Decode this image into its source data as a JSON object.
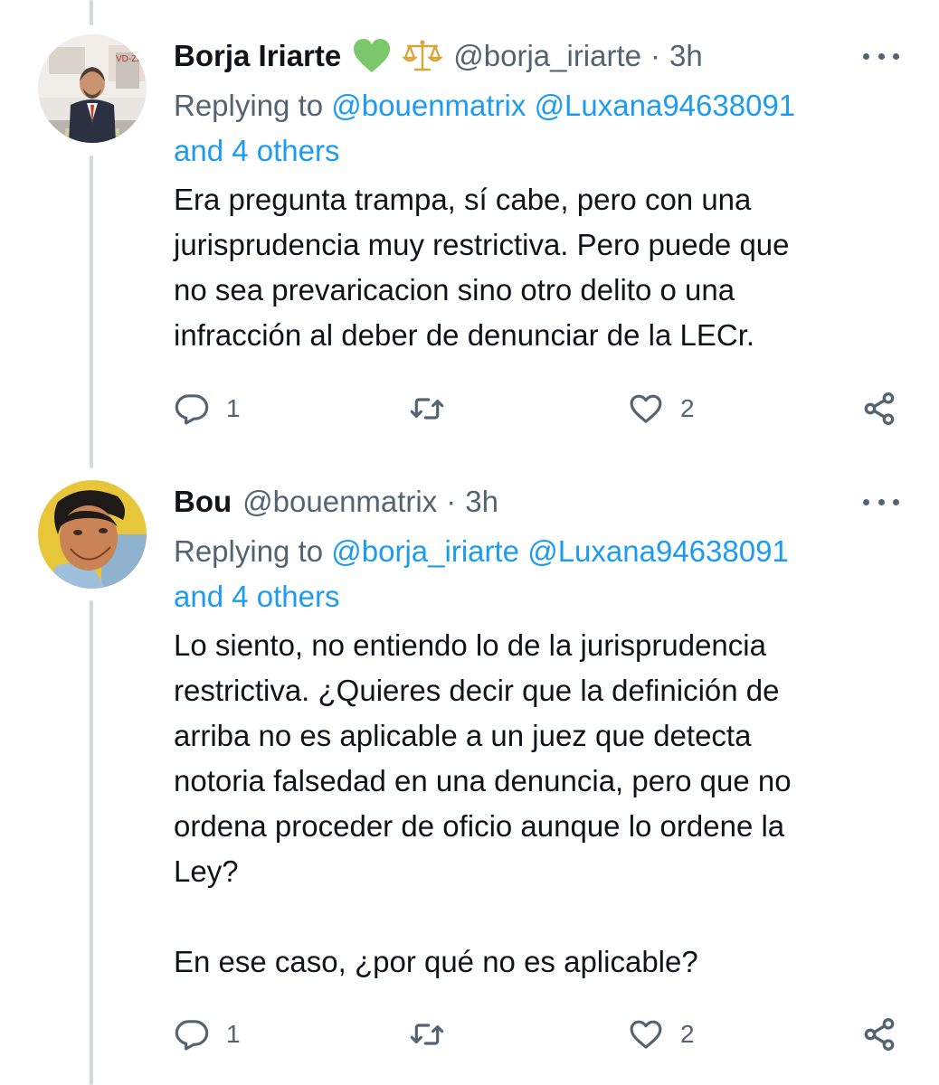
{
  "tweets": [
    {
      "name": "Borja Iriarte",
      "handle": "@borja_iriarte",
      "sep": "·",
      "time": "3h",
      "badges": [
        "green-heart-icon",
        "scales-icon"
      ],
      "replying_prefix": "Replying to",
      "replying_mentions": [
        "@bouenmatrix",
        "@Luxana94638091"
      ],
      "replying_others": "and 4 others",
      "text": "Era pregunta trampa, sí cabe, pero con una\njurisprudencia muy restrictiva. Pero puede que\nno sea prevaricacion sino otro delito o una\ninfracción al deber de denunciar de la LECr.",
      "replies": "1",
      "retweets": "",
      "likes": "2"
    },
    {
      "name": "Bou",
      "handle": "@bouenmatrix",
      "sep": "·",
      "time": "3h",
      "badges": [],
      "replying_prefix": "Replying to",
      "replying_mentions": [
        "@borja_iriarte",
        "@Luxana94638091"
      ],
      "replying_others": "and 4 others",
      "text": "Lo siento, no entiendo lo de la jurisprudencia\nrestrictiva. ¿Quieres decir que la definición de\narriba no es aplicable a un juez que detecta\nnotoria falsedad en una denuncia, pero que no\nordena proceder de oficio aunque lo ordene la\nLey?\n\nEn ese caso, ¿por qué no es aplicable?",
      "replies": "1",
      "retweets": "",
      "likes": "2"
    }
  ],
  "colors": {
    "link": "#1d9bf0",
    "secondary": "#536471",
    "text": "#0f1419",
    "thread_line": "#cfd9de",
    "heart_badge": "#7bc86c"
  }
}
